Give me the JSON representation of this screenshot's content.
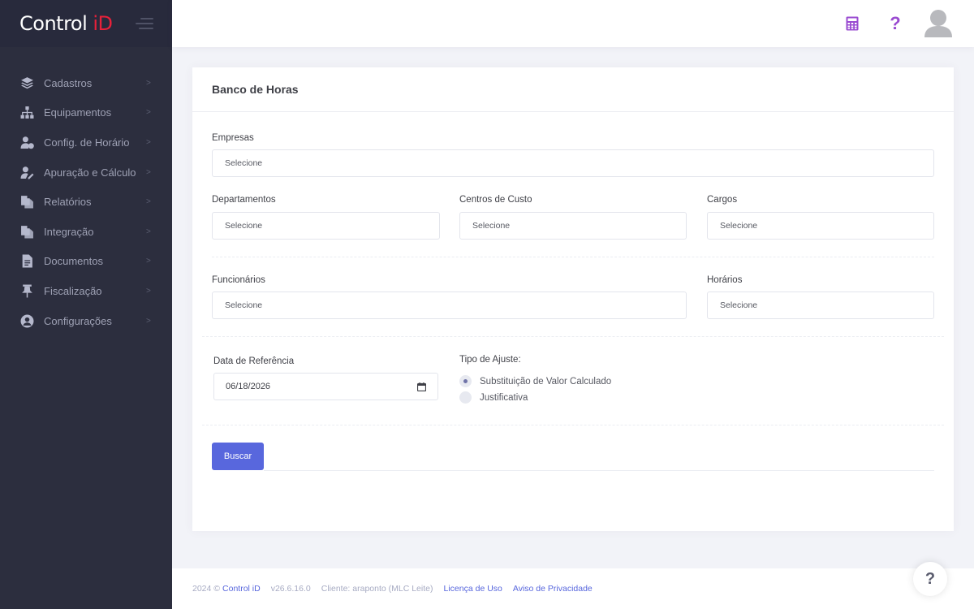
{
  "brand": {
    "main": "Control ",
    "accent": "iD"
  },
  "sidebar": {
    "items": [
      {
        "label": "Cadastros",
        "icon": "layers-icon"
      },
      {
        "label": "Equipamentos",
        "icon": "sitemap-icon"
      },
      {
        "label": "Config. de Horário",
        "icon": "user-clock-icon"
      },
      {
        "label": "Apuração e Cálculo",
        "icon": "user-edit-icon"
      },
      {
        "label": "Relatórios",
        "icon": "copy-icon"
      },
      {
        "label": "Integração",
        "icon": "copy-icon"
      },
      {
        "label": "Documentos",
        "icon": "document-icon"
      },
      {
        "label": "Fiscalização",
        "icon": "pin-icon"
      },
      {
        "label": "Configurações",
        "icon": "user-circle-icon"
      }
    ],
    "chevron": ">"
  },
  "topbar": {
    "help_symbol": "?"
  },
  "card": {
    "title": "Banco de Horas",
    "empresas": {
      "label": "Empresas",
      "placeholder": "Selecione"
    },
    "departamentos": {
      "label": "Departamentos",
      "placeholder": "Selecione"
    },
    "centros_custo": {
      "label": "Centros de Custo",
      "placeholder": "Selecione"
    },
    "cargos": {
      "label": "Cargos",
      "placeholder": "Selecione"
    },
    "funcionarios": {
      "label": "Funcionários",
      "placeholder": "Selecione"
    },
    "horarios": {
      "label": "Horários",
      "placeholder": "Selecione"
    },
    "data_referencia": {
      "label": "Data de Referência",
      "value": "06/18/2026"
    },
    "tipo_ajuste": {
      "label": "Tipo de Ajuste:",
      "options": [
        "Substituição de Valor Calculado",
        "Justificativa"
      ],
      "selected": 0
    },
    "buscar_label": "Buscar"
  },
  "footer": {
    "year": "2024 ©",
    "company": "Control iD",
    "version": "v26.6.16.0",
    "client": "Cliente: araponto (MLC Leite)",
    "license": "Licença de Uso",
    "privacy": "Aviso de Privacidade"
  },
  "help_fab": "?",
  "colors": {
    "sidebar": "#2c2e3e",
    "brand_accent": "#e8213a",
    "primary": "#5867dd",
    "help_icon": "#9a4bd1"
  }
}
